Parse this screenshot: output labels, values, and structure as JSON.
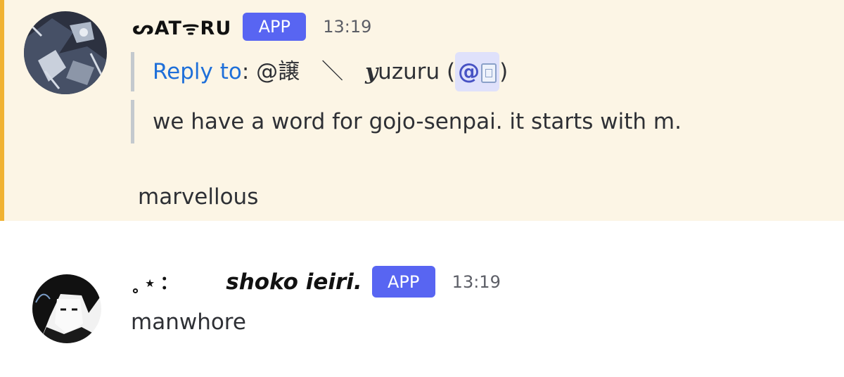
{
  "messages": [
    {
      "username": "ᔕATᯤRU",
      "badge": "APP",
      "time": "13:19",
      "reply_label": "Reply to",
      "reply_target": ": @譲　＼　",
      "reply_target_name_prefix": "y",
      "reply_target_name": "uzuru (",
      "reply_mention": "@",
      "reply_close": ")",
      "quoted_text": "we have a word for gojo-senpai. it starts with m.",
      "content": "marvellous"
    },
    {
      "username_prefix": "˳⋆：",
      "username": "shoko ieiri.",
      "badge": "APP",
      "time": "13:19",
      "content": "manwhore"
    }
  ],
  "colors": {
    "highlight_bg": "#fcf5e5",
    "highlight_bar": "#f0b232",
    "badge": "#5865f2",
    "reply_link": "#1e6fd9"
  }
}
